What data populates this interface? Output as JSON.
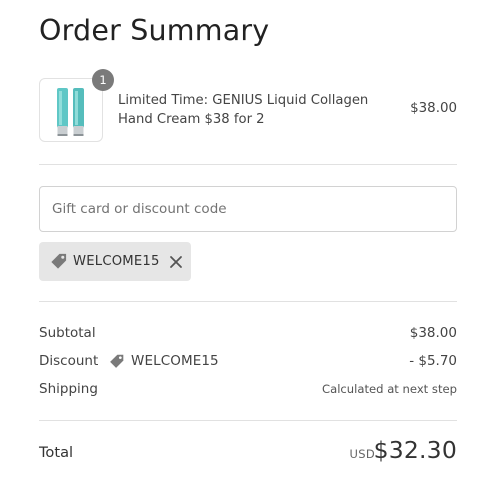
{
  "summary": {
    "title": "Order Summary"
  },
  "product": {
    "quantity": "1",
    "name": "Limited Time: GENIUS Liquid Collagen Hand Cream $38 for 2",
    "price": "$38.00",
    "image_icon": "hand-cream-tubes",
    "image_color": "#5fc7c6"
  },
  "discount": {
    "input_placeholder": "Gift card or discount code",
    "input_value": "",
    "applied_code": "WELCOME15",
    "tag_icon": "price-tag-icon",
    "remove_icon": "close-icon"
  },
  "lines": {
    "subtotal_label": "Subtotal",
    "subtotal_value": "$38.00",
    "discount_label": "Discount",
    "discount_code": "WELCOME15",
    "discount_value": "- $5.70",
    "shipping_label": "Shipping",
    "shipping_value": "Calculated at next step"
  },
  "total": {
    "label": "Total",
    "currency": "USD",
    "amount": "$32.30"
  },
  "colors": {
    "divider": "#e1e1e1",
    "tag_background": "#e6e6e6",
    "badge": "#7a7a7a",
    "text": "#333333"
  }
}
